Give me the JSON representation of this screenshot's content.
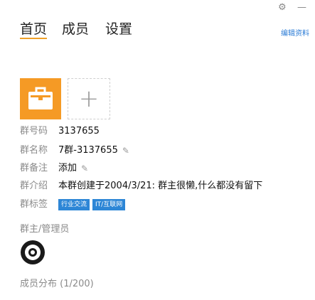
{
  "tabs": [
    {
      "label": "首页"
    },
    {
      "label": "成员"
    },
    {
      "label": "设置"
    }
  ],
  "window_controls": {
    "settings_glyph": "⚙",
    "minimize_glyph": "—"
  },
  "edit_link": "编辑资料",
  "group_avatar": {
    "icon": "briefcase-icon",
    "color": "#f59a25"
  },
  "add_button": {
    "glyph": "+"
  },
  "info": {
    "group_number_label": "群号码",
    "group_number_value": "3137655",
    "group_name_label": "群名称",
    "group_name_value": "7群-3137655",
    "group_note_label": "群备注",
    "group_note_value": "添加",
    "group_intro_label": "群介绍",
    "group_intro_value": "本群创建于2004/3/21:  群主很懒,什么都没有留下",
    "group_tags_label": "群标签",
    "tags": [
      "行业交流",
      "IT/互联网"
    ]
  },
  "admins": {
    "title": "群主/管理员"
  },
  "members": {
    "title": "成员分布 (1/200)"
  }
}
